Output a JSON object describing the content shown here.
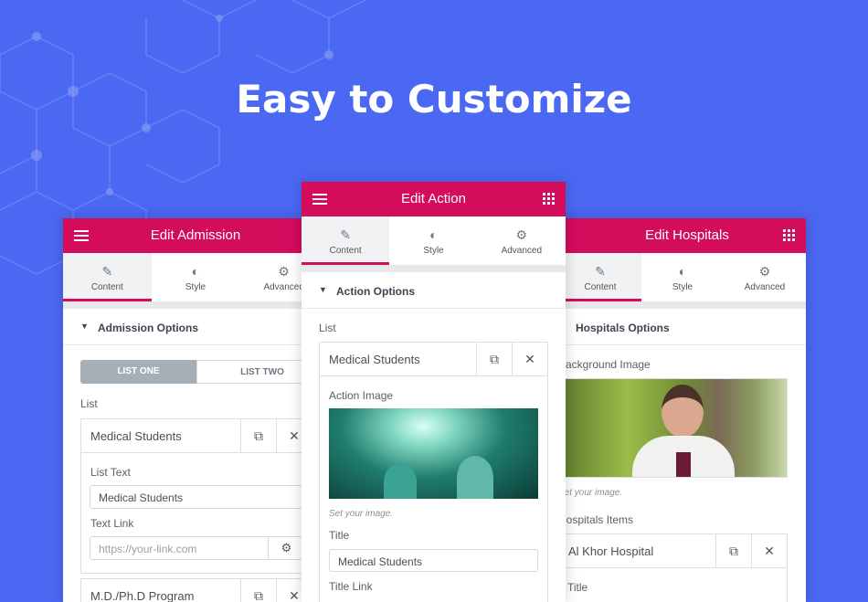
{
  "headline": "Easy to Customize",
  "colors": {
    "background": "#4a68f2",
    "header": "#d30c5c",
    "active_tab_underline": "#d30c5c"
  },
  "tabs": {
    "content": "Content",
    "style": "Style",
    "advanced": "Advanced"
  },
  "left": {
    "title": "Edit Admission",
    "section": "Admission Options",
    "list_tabs": [
      "LIST ONE",
      "LIST TWO"
    ],
    "list_label": "List",
    "items": [
      {
        "title": "Medical Students",
        "list_text_label": "List Text",
        "list_text": "Medical Students",
        "text_link_label": "Text Link",
        "text_link_placeholder": "https://your-link.com"
      },
      {
        "title": "M.D./Ph.D Program"
      }
    ]
  },
  "center": {
    "title": "Edit Action",
    "section": "Action Options",
    "list_label": "List",
    "item_title": "Medical Students",
    "image_label": "Action Image",
    "image_note": "Set your image.",
    "title_label": "Title",
    "title_value": "Medical Students",
    "title_link_label": "Title Link"
  },
  "right": {
    "title": "Edit Hospitals",
    "section": "Hospitals Options",
    "bg_label": "Background Image",
    "image_note": "Set your image.",
    "items_label": "Hospitals Items",
    "item_title": "Al Khor Hospital",
    "title_label": "Title"
  },
  "icons": {
    "menu": "hamburger-icon",
    "apps": "grid-icon",
    "content": "pencil-icon",
    "style": "half-circle-icon",
    "advanced": "gear-icon",
    "duplicate": "copy-icon",
    "remove": "close-icon",
    "caret": "caret-down-icon"
  }
}
